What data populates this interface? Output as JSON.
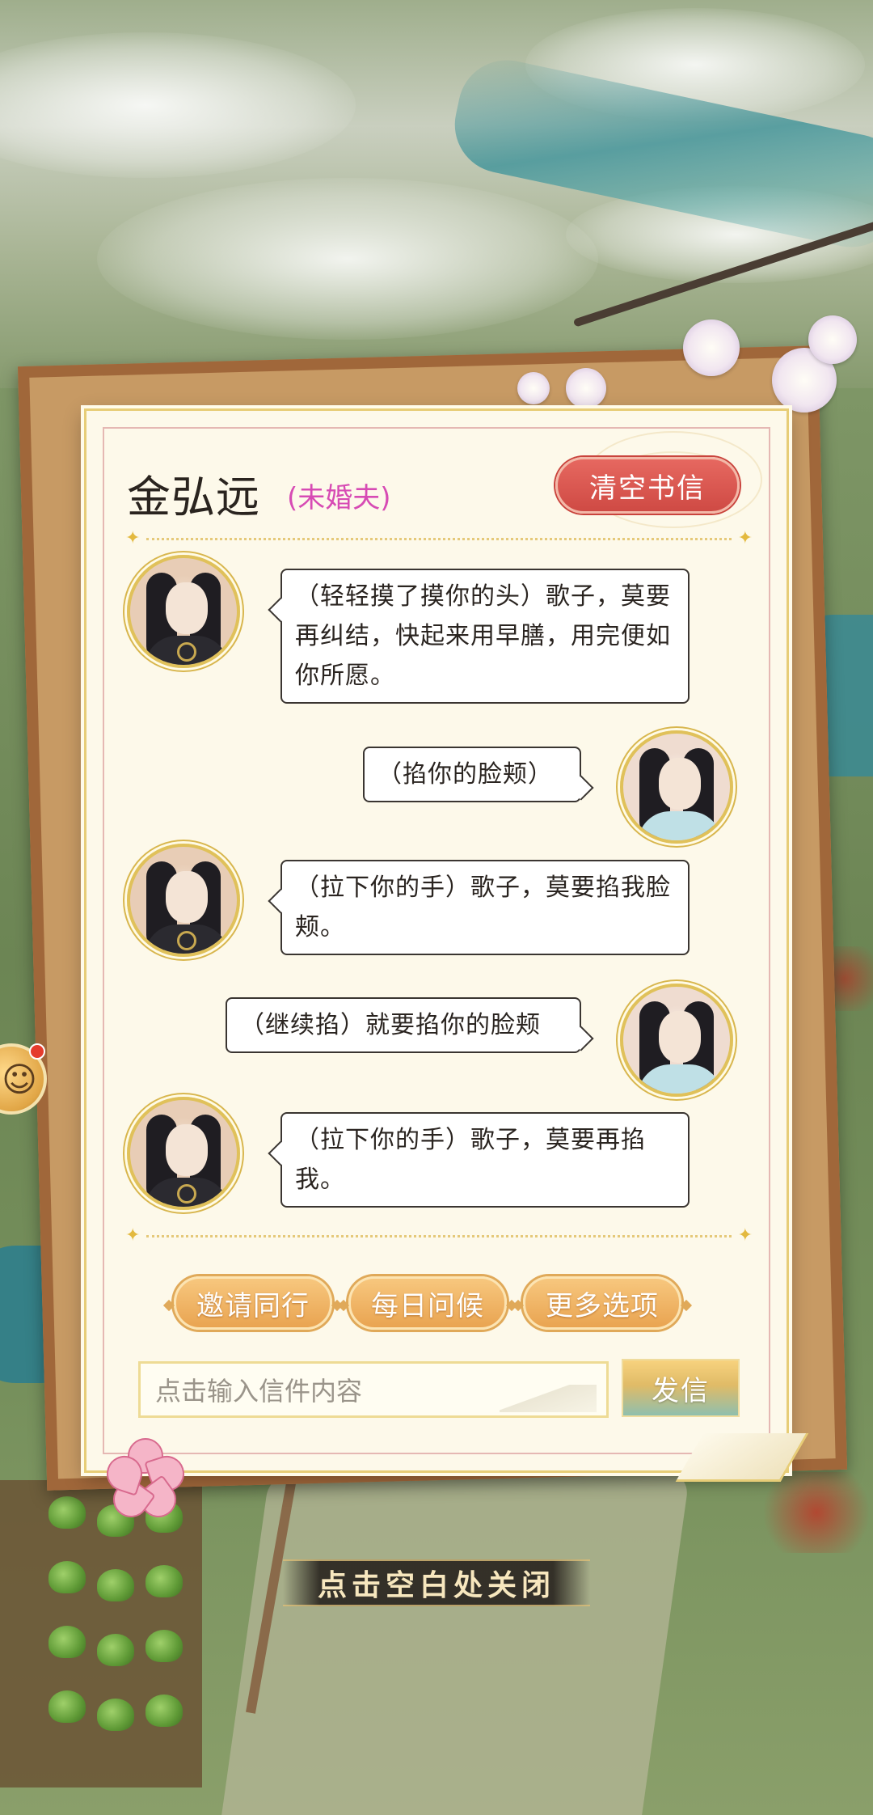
{
  "letter": {
    "contact_name": "金弘远",
    "relation_tag": "(未婚夫)",
    "clear_button": "清空书信",
    "messages": [
      {
        "sender": "male",
        "text": "（轻轻摸了摸你的头）歌子，莫要再纠结，快起来用早膳，用完便如你所愿。"
      },
      {
        "sender": "female",
        "text": "（掐你的脸颊）"
      },
      {
        "sender": "male",
        "text": "（拉下你的手）歌子，莫要掐我脸颊。"
      },
      {
        "sender": "female",
        "text": "（继续掐）就要掐你的脸颊"
      },
      {
        "sender": "male",
        "text": "（拉下你的手）歌子，莫要再掐我。"
      }
    ],
    "actions": [
      "邀请同行",
      "每日问候",
      "更多选项"
    ],
    "input_placeholder": "点击输入信件内容",
    "send_button": "发信"
  },
  "close_hint": "点击空白处关闭",
  "colors": {
    "clear_button": "#d9534f",
    "relation_tag": "#d74bb4",
    "action_button": "#f0b463",
    "paper": "#fdf9ea",
    "gold_border": "#e7cd77"
  },
  "icons": [
    "chat-bubble-icon",
    "notification-dot",
    "plum-blossom-icon",
    "male-avatar",
    "female-avatar"
  ]
}
